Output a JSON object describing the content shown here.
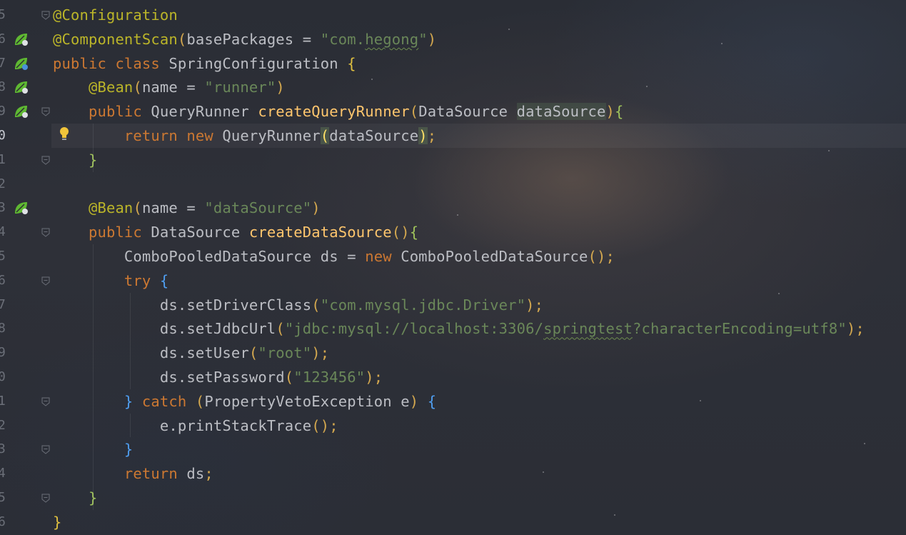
{
  "editor": {
    "first_line_number": 5,
    "current_line_index": 5,
    "lines": [
      {
        "num": "5",
        "tokens": [
          [
            "ann",
            "@Configuration"
          ]
        ]
      },
      {
        "num": "6",
        "tokens": [
          [
            "ann",
            "@ComponentScan"
          ],
          [
            "punc",
            "("
          ],
          [
            "param",
            "basePackages = "
          ],
          [
            "str",
            "\"com."
          ],
          [
            "str sq",
            "hegong"
          ],
          [
            "str",
            "\""
          ],
          [
            "punc",
            ")"
          ]
        ]
      },
      {
        "num": "7",
        "tokens": [
          [
            "kw",
            "public class "
          ],
          [
            "cls",
            "SpringConfiguration "
          ],
          [
            "brace-y",
            "{"
          ]
        ]
      },
      {
        "num": "8",
        "tokens": [
          [
            "ann",
            "    @Bean"
          ],
          [
            "punc",
            "("
          ],
          [
            "param",
            "name = "
          ],
          [
            "str",
            "\"runner\""
          ],
          [
            "punc",
            ")"
          ]
        ]
      },
      {
        "num": "9",
        "tokens": [
          [
            "kw",
            "    public "
          ],
          [
            "cls",
            "QueryRunner "
          ],
          [
            "mth",
            "createQueryRunner"
          ],
          [
            "punc",
            "("
          ],
          [
            "cls",
            "DataSource "
          ],
          [
            "param hl-param",
            "dataSource"
          ],
          [
            "punc",
            ")"
          ],
          [
            "brace-g",
            "{"
          ]
        ]
      },
      {
        "num": "0",
        "tokens": [
          [
            "kw",
            "        return new "
          ],
          [
            "cls",
            "QueryRunner"
          ],
          [
            "hl-paren",
            "("
          ],
          [
            "param",
            "dataSource"
          ],
          [
            "hl-paren",
            ")"
          ],
          [
            "punc",
            ";"
          ]
        ]
      },
      {
        "num": "1",
        "tokens": [
          [
            "brace-g",
            "    }"
          ]
        ]
      },
      {
        "num": "2",
        "tokens": []
      },
      {
        "num": "3",
        "tokens": [
          [
            "ann",
            "    @Bean"
          ],
          [
            "punc",
            "("
          ],
          [
            "param",
            "name = "
          ],
          [
            "str",
            "\"dataSource\""
          ],
          [
            "punc",
            ")"
          ]
        ]
      },
      {
        "num": "4",
        "tokens": [
          [
            "kw",
            "    public "
          ],
          [
            "cls",
            "DataSource "
          ],
          [
            "mth",
            "createDataSource"
          ],
          [
            "punc",
            "()"
          ],
          [
            "brace-g",
            "{"
          ]
        ]
      },
      {
        "num": "5",
        "tokens": [
          [
            "cls",
            "        ComboPooledDataSource ds = "
          ],
          [
            "kw",
            "new "
          ],
          [
            "cls",
            "ComboPooledDataSource"
          ],
          [
            "punc",
            "();"
          ]
        ]
      },
      {
        "num": "6",
        "tokens": [
          [
            "kw",
            "        try "
          ],
          [
            "brace-b",
            "{"
          ]
        ]
      },
      {
        "num": "7",
        "tokens": [
          [
            "cls",
            "            ds.setDriverClass"
          ],
          [
            "punc",
            "("
          ],
          [
            "str",
            "\"com.mysql.jdbc.Driver\""
          ],
          [
            "punc",
            ");"
          ]
        ]
      },
      {
        "num": "8",
        "tokens": [
          [
            "cls",
            "            ds.setJdbcUrl"
          ],
          [
            "punc",
            "("
          ],
          [
            "str",
            "\"jdbc:mysql://localhost:3306/"
          ],
          [
            "str sq",
            "springtest"
          ],
          [
            "str",
            "?characterEncoding=utf8\""
          ],
          [
            "punc",
            ");"
          ]
        ]
      },
      {
        "num": "9",
        "tokens": [
          [
            "cls",
            "            ds.setUser"
          ],
          [
            "punc",
            "("
          ],
          [
            "str",
            "\"root\""
          ],
          [
            "punc",
            ");"
          ]
        ]
      },
      {
        "num": "0",
        "tokens": [
          [
            "cls",
            "            ds.setPassword"
          ],
          [
            "punc",
            "("
          ],
          [
            "str",
            "\"123456\""
          ],
          [
            "punc",
            ");"
          ]
        ]
      },
      {
        "num": "1",
        "tokens": [
          [
            "brace-b",
            "        } "
          ],
          [
            "kw",
            "catch "
          ],
          [
            "punc",
            "("
          ],
          [
            "cls",
            "PropertyVetoException e"
          ],
          [
            "punc",
            ") "
          ],
          [
            "brace-b",
            "{"
          ]
        ]
      },
      {
        "num": "2",
        "tokens": [
          [
            "cls",
            "            e.printStackTrace"
          ],
          [
            "punc",
            "();"
          ]
        ]
      },
      {
        "num": "3",
        "tokens": [
          [
            "brace-b",
            "        }"
          ]
        ]
      },
      {
        "num": "4",
        "tokens": [
          [
            "kw",
            "        return "
          ],
          [
            "cls",
            "ds"
          ],
          [
            "punc",
            ";"
          ]
        ]
      },
      {
        "num": "5",
        "tokens": [
          [
            "brace-g",
            "    }"
          ]
        ]
      },
      {
        "num": "6",
        "tokens": [
          [
            "brace-y",
            "}"
          ]
        ]
      }
    ]
  },
  "gutter_icons": [
    {
      "line_index": 1,
      "icon": "spring-bean-search-icon"
    },
    {
      "line_index": 2,
      "icon": "spring-bean-config-icon"
    },
    {
      "line_index": 3,
      "icon": "spring-bean-navigate-icon"
    },
    {
      "line_index": 4,
      "icon": "spring-bean-navigate-icon"
    },
    {
      "line_index": 8,
      "icon": "spring-bean-navigate-icon"
    }
  ],
  "fold_markers": [
    0,
    4,
    6,
    9,
    11,
    16,
    18,
    20
  ],
  "colors": {
    "annotation": "#bbb529",
    "keyword": "#cc7832",
    "string": "#6a8759",
    "method": "#ffc66d",
    "text": "#bcbec4",
    "spring_green": "#5fb832"
  }
}
